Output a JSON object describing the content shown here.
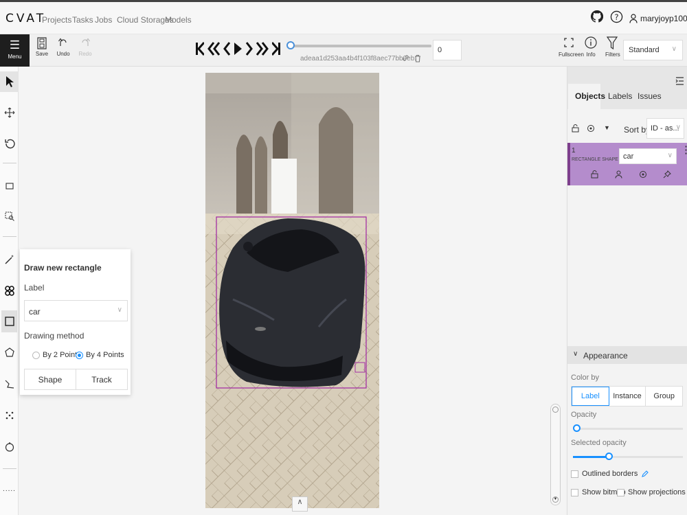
{
  "app": {
    "logo": "CVAT",
    "nav": [
      "Projects",
      "Tasks",
      "Jobs",
      "Cloud Storages",
      "Models"
    ],
    "username": "maryjoyp100"
  },
  "toolbar": {
    "menu_label": "Menu",
    "save_label": "Save",
    "undo_label": "Undo",
    "redo_label": "Redo",
    "frame_name": "adeaa1d253aa4b4f103f8aec77bb0eb.",
    "frame_number": "0",
    "fullscreen_label": "Fullscreen",
    "info_label": "Info",
    "filters_label": "Filters",
    "workspace": "Standard",
    "slider_position": 0
  },
  "popover": {
    "title": "Draw new rectangle",
    "label_heading": "Label",
    "label_value": "car",
    "method_heading": "Drawing method",
    "method_options": [
      "By 2 Points",
      "By 4 Points"
    ],
    "method_selected": "By 4 Points",
    "shape_button": "Shape",
    "track_button": "Track"
  },
  "sidebar": {
    "tabs": [
      "Objects",
      "Labels",
      "Issues"
    ],
    "active_tab": "Objects",
    "sort_label": "Sort by",
    "sort_value": "ID - as...",
    "object": {
      "id": "1",
      "type": "RECTANGLE SHAPE",
      "label": "car",
      "color": "#b48ccc"
    },
    "appearance": {
      "title": "Appearance",
      "color_by_label": "Color by",
      "color_by_options": [
        "Label",
        "Instance",
        "Group"
      ],
      "color_by_selected": "Label",
      "opacity_label": "Opacity",
      "opacity_value": 0,
      "selected_opacity_label": "Selected opacity",
      "selected_opacity_value": 0.4,
      "outlined_borders": "Outlined borders",
      "show_bitmap": "Show bitmap",
      "show_projections": "Show projections"
    }
  },
  "colors": {
    "accent": "#1890ff",
    "annotation": "#a330a3",
    "menu_bg": "#1e1e1e"
  }
}
